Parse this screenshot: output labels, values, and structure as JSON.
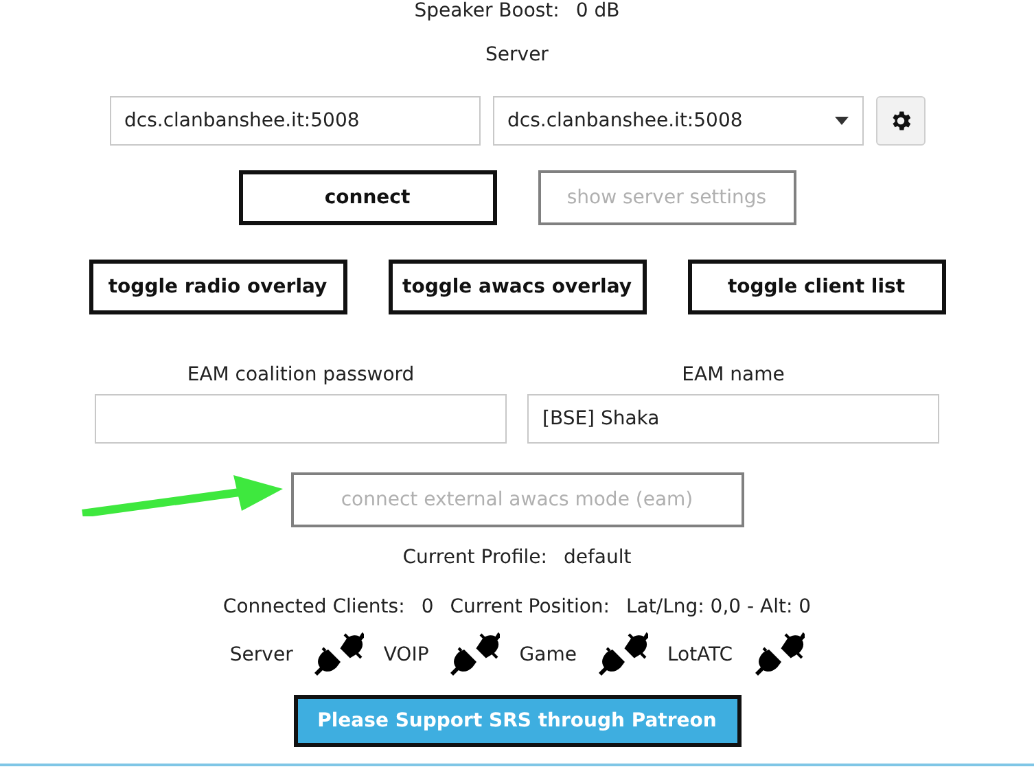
{
  "speaker_boost": {
    "label": "Speaker Boost:",
    "value": "0 dB"
  },
  "server": {
    "heading": "Server",
    "address_field": "dcs.clanbanshee.it:5008",
    "server_dropdown": "dcs.clanbanshee.it:5008"
  },
  "server_buttons": [
    {
      "label": "connect",
      "disabled": false
    },
    {
      "label": "show server settings",
      "disabled": true
    }
  ],
  "toggle_buttons": [
    {
      "label": "toggle radio overlay",
      "disabled": false
    },
    {
      "label": "toggle awacs overlay",
      "disabled": false
    },
    {
      "label": "toggle client list",
      "disabled": false
    }
  ],
  "eam": {
    "password_label": "EAM coalition password",
    "name_label": "EAM name",
    "name_value": "[BSE] Shaka",
    "connect_button": {
      "label": "connect external awacs mode (eam)",
      "disabled": true
    }
  },
  "profile": {
    "label": "Current Profile:",
    "value": "default"
  },
  "info": {
    "clients_label": "Connected Clients:",
    "clients_value": "0",
    "position_label": "Current Position:",
    "position_value": "Lat/Lng: 0,0 - Alt: 0"
  },
  "statuses": [
    {
      "label": "Server",
      "connected": false
    },
    {
      "label": "VOIP",
      "connected": false
    },
    {
      "label": "Game",
      "connected": false
    },
    {
      "label": "LotATC",
      "connected": false
    }
  ],
  "patreon_button": "Please Support SRS through Patreon"
}
